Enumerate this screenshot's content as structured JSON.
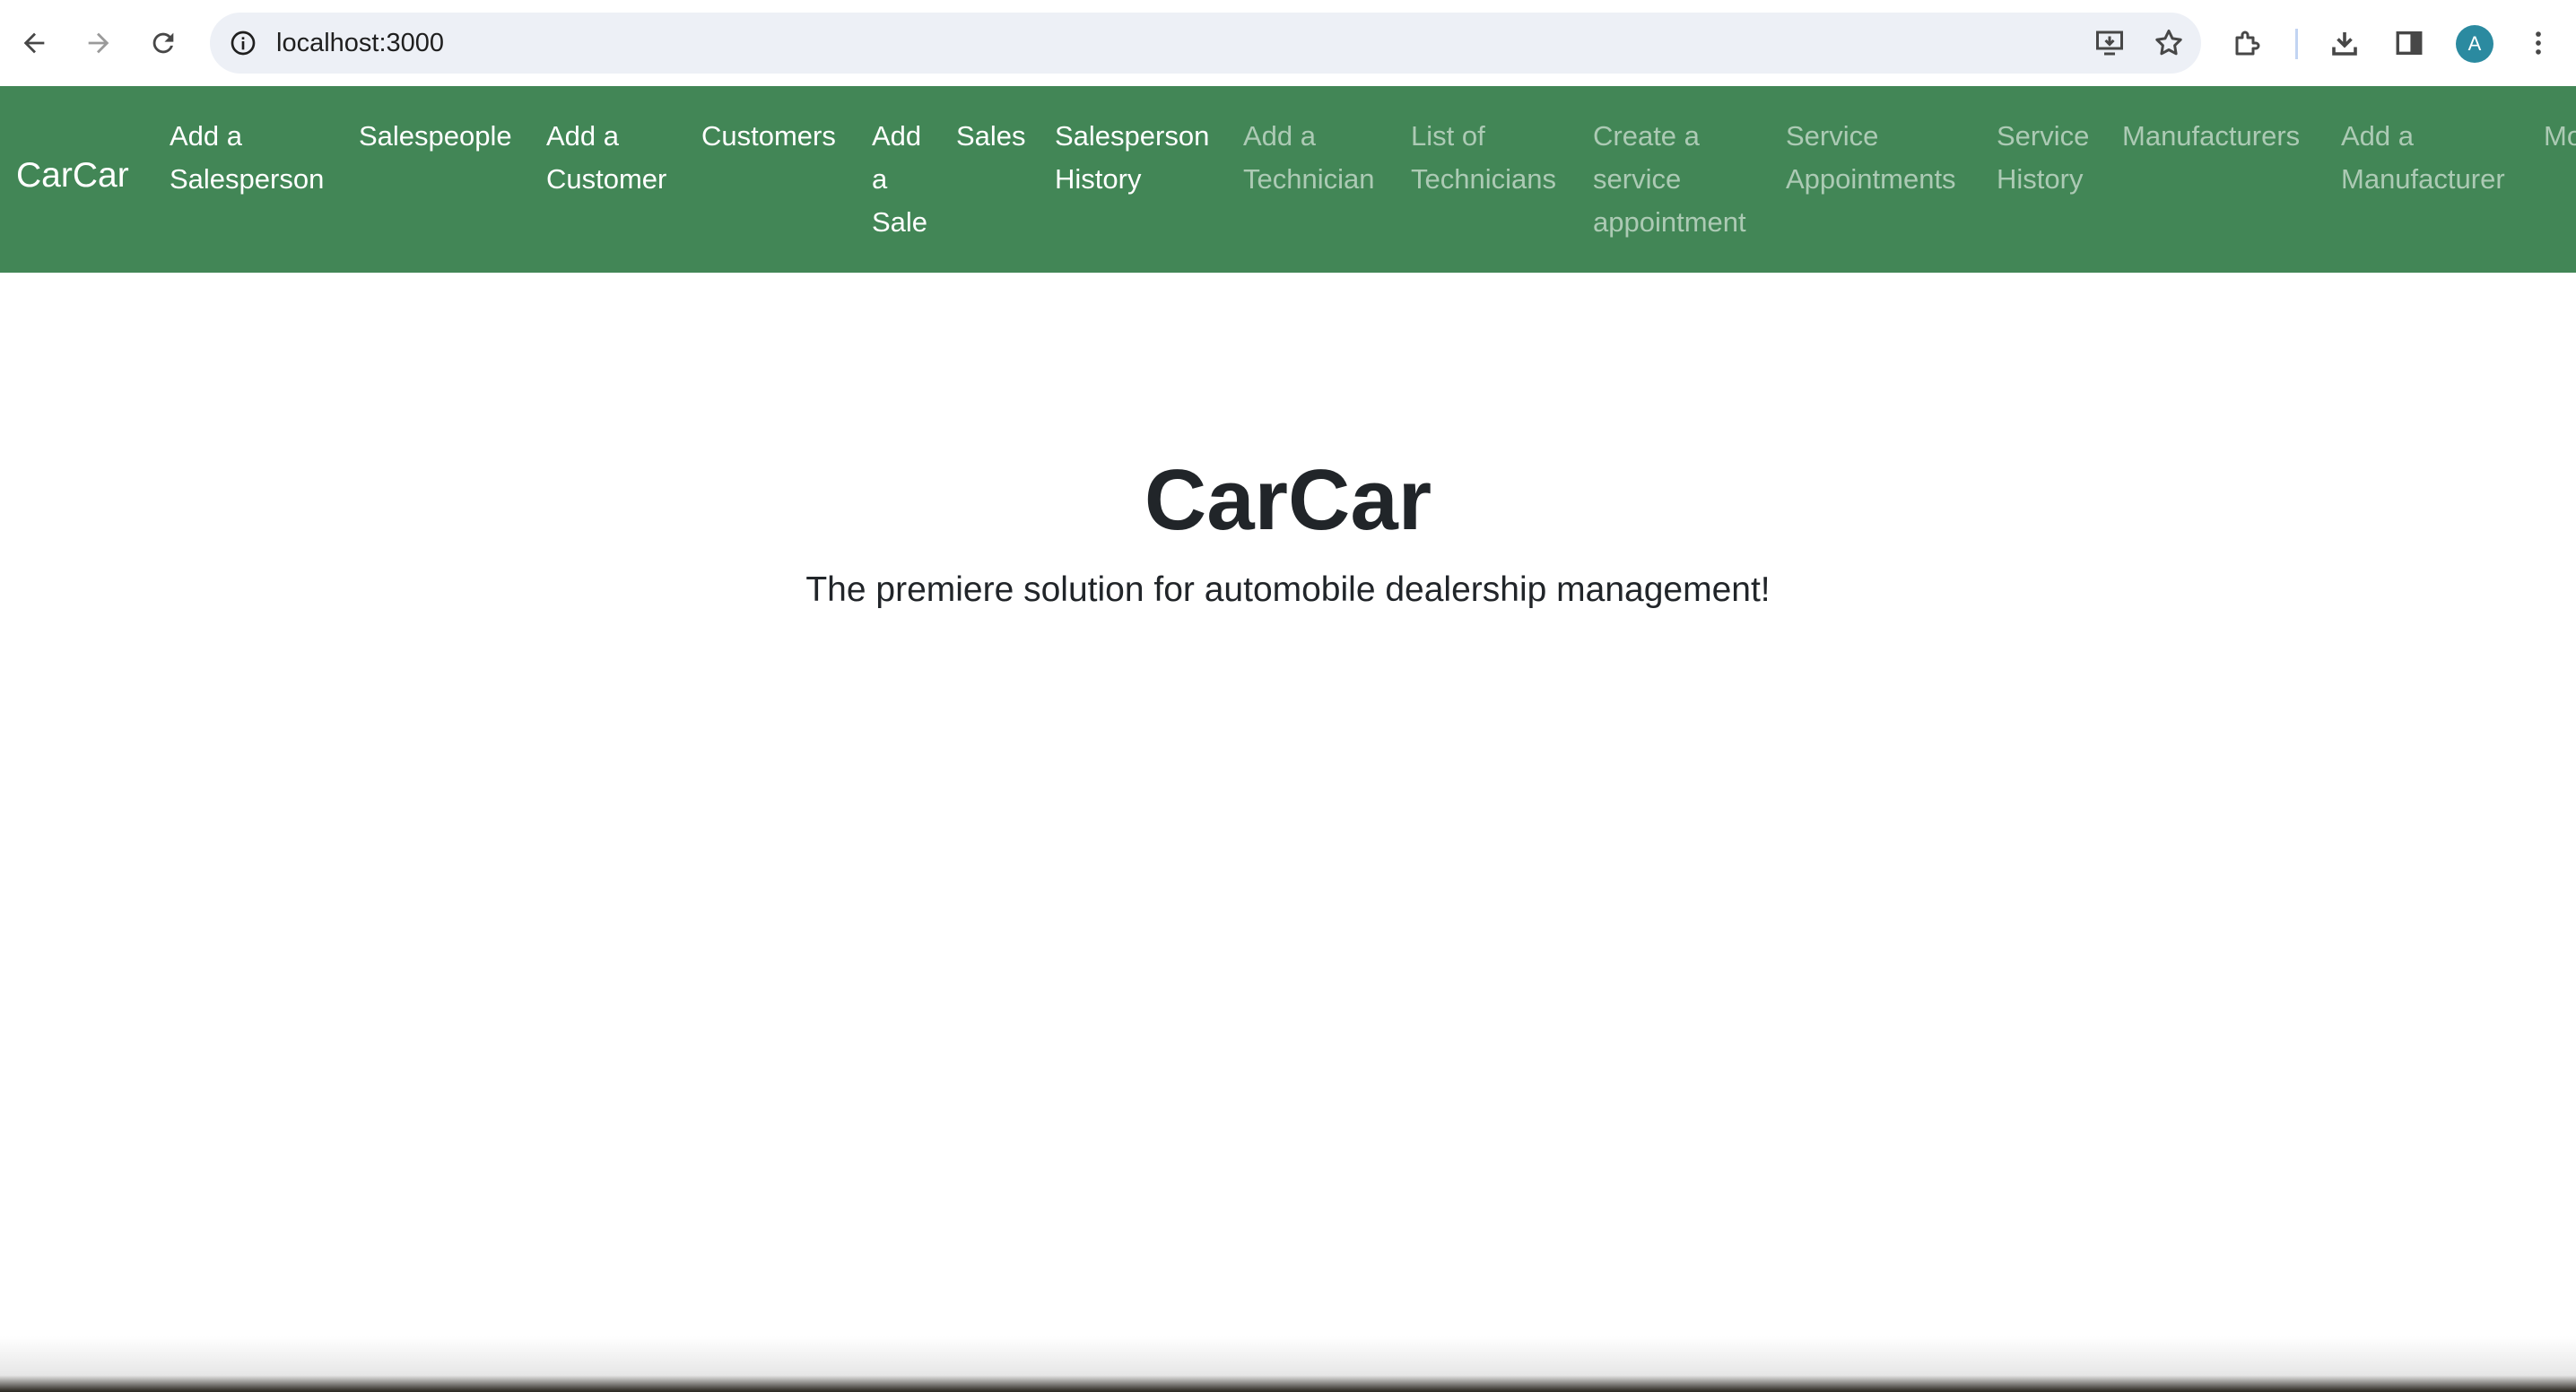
{
  "browser": {
    "url": "localhost:3000",
    "profile_initial": "A",
    "icons": {
      "back": "back-arrow-icon",
      "forward": "forward-arrow-icon",
      "reload": "reload-icon",
      "site_info": "info-icon",
      "install": "install-app-icon",
      "bookmark": "star-icon",
      "extensions": "puzzle-icon",
      "downloads": "download-icon",
      "side_panel": "side-panel-icon",
      "menu": "kebab-menu-icon"
    }
  },
  "navbar": {
    "brand": "CarCar",
    "background_color": "#428656",
    "items": [
      {
        "label": "Add a Salesperson",
        "active": true
      },
      {
        "label": "Salespeople",
        "active": true
      },
      {
        "label": "Add a Customer",
        "active": true
      },
      {
        "label": "Customers",
        "active": true
      },
      {
        "label": "Add a Sale",
        "active": true
      },
      {
        "label": "Sales",
        "active": true
      },
      {
        "label": "Salesperson History",
        "active": true
      },
      {
        "label": "Add a Technician",
        "active": false
      },
      {
        "label": "List of Technicians",
        "active": false
      },
      {
        "label": "Create a service appointment",
        "active": false
      },
      {
        "label": "Service Appointments",
        "active": false
      },
      {
        "label": "Service History",
        "active": false
      },
      {
        "label": "Manufacturers",
        "active": false
      },
      {
        "label": "Add a Manufacturer",
        "active": false
      },
      {
        "label": "Mo",
        "active": false
      }
    ]
  },
  "main": {
    "title": "CarCar",
    "lead": "The premiere solution for automobile dealership management!"
  }
}
